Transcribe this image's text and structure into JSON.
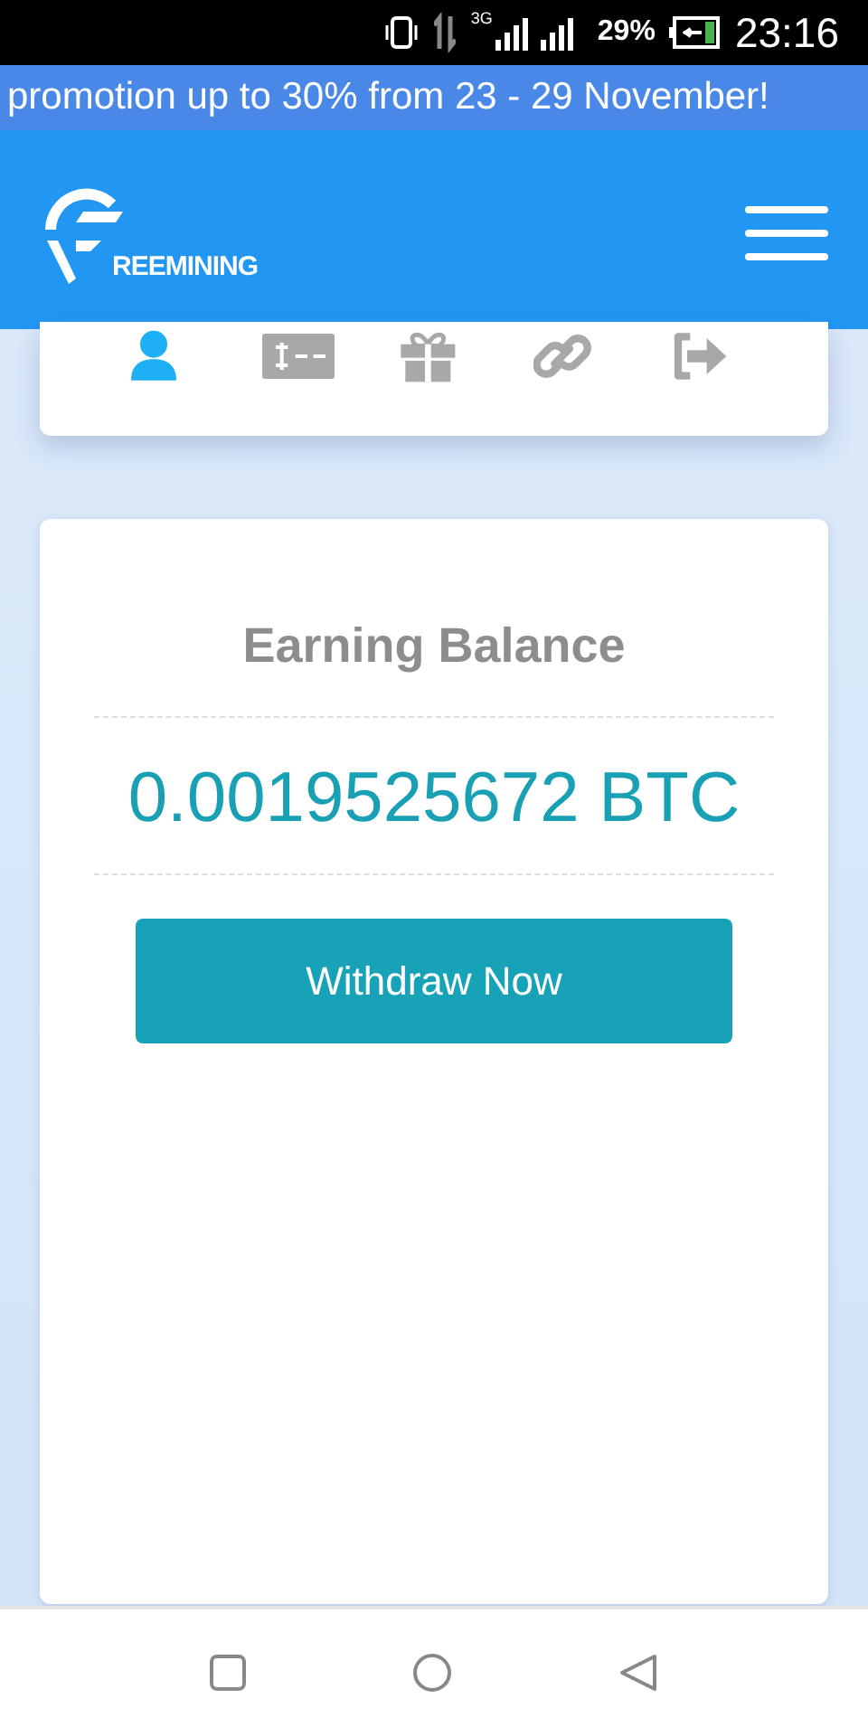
{
  "status_bar": {
    "network": "3G",
    "battery": "29%",
    "time": "23:16"
  },
  "promo_banner": "promotion up to 30% from 23 - 29 November!",
  "header": {
    "logo_text": "REEMINING"
  },
  "tabs": [
    {
      "kind": "user",
      "selected": true
    },
    {
      "kind": "bill",
      "selected": false
    },
    {
      "kind": "gift",
      "selected": false
    },
    {
      "kind": "link",
      "selected": false
    },
    {
      "kind": "logout",
      "selected": false
    }
  ],
  "balance": {
    "title": "Earning Balance",
    "amount": "0.0019525672 BTC",
    "button": "Withdraw Now"
  }
}
